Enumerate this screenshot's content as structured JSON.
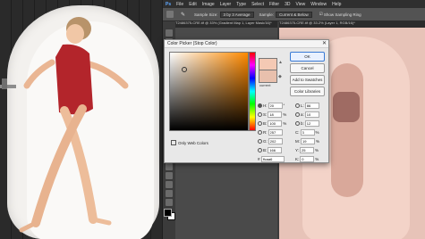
{
  "menubar": [
    "Ps",
    "File",
    "Edit",
    "Image",
    "Layer",
    "Type",
    "Select",
    "Filter",
    "3D",
    "View",
    "Window",
    "Help"
  ],
  "options": {
    "sample_size_label": "Sample Size:",
    "sample_size_value": "3 by 3 Average",
    "sample_label": "Sample:",
    "sample_value": "Current & Below",
    "show_ring_label": "Show Sampling Ring"
  },
  "tabs": {
    "left": "T2486375-CRE.tif @ 33% (Gradient Map 1, Layer Mask/16)*",
    "right": "T2486375-CRE.tif @ 33.2% (Layer 1, RGB/16)*"
  },
  "dialog": {
    "title": "Color Picker (Stop Color)",
    "ok": "OK",
    "cancel": "Cancel",
    "add_swatches": "Add to Swatches",
    "color_libraries": "Color Libraries",
    "current_label": "current",
    "only_web": "Only Web Colors",
    "fields": [
      {
        "l": "H:",
        "v": "20",
        "u": "°",
        "l2": "L:",
        "v2": "86"
      },
      {
        "l": "S:",
        "v": "18",
        "u": "%",
        "l2": "a:",
        "v2": "10"
      },
      {
        "l": "B:",
        "v": "100",
        "u": "%",
        "l2": "b:",
        "v2": "12"
      },
      {
        "l": "R:",
        "v": "257",
        "u": "",
        "l2": "C:",
        "v2": "3",
        "u2": "%"
      },
      {
        "l": "G:",
        "v": "202",
        "u": "",
        "l2": "M:",
        "v2": "19",
        "u2": "%"
      },
      {
        "l": "B:",
        "v": "166",
        "u": "",
        "l2": "Y:",
        "v2": "25",
        "u2": "%"
      }
    ],
    "k_label": "K:",
    "k_value": "0",
    "k_unit": "%",
    "hex_label": "#",
    "hex_value": "ffcaa6",
    "new_color": "#f4c9b4",
    "current_color": "#e8c0ad"
  }
}
